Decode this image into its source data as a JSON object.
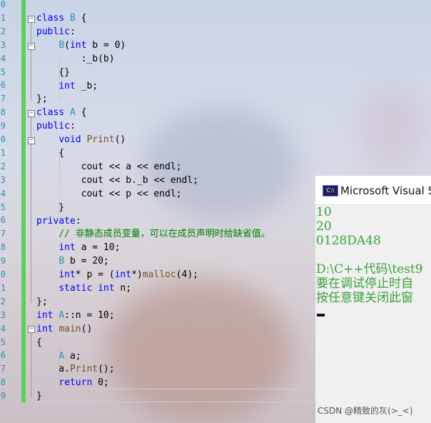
{
  "editor": {
    "line_numbers": [
      "0",
      "1",
      "2",
      "3",
      "4",
      "5",
      "6",
      "7",
      "8",
      "9",
      "0",
      "1",
      "2",
      "3",
      "4",
      "5",
      "6",
      "7",
      "8",
      "9",
      "0",
      "1",
      "2",
      "3",
      "4",
      "5",
      "6",
      "7",
      "8",
      "9"
    ],
    "code": [
      "class B {",
      "public:",
      "    B(int b = 0)",
      "        :_b(b)",
      "    {}",
      "    int _b;",
      "};",
      "class A {",
      "public:",
      "    void Print()",
      "    {",
      "        cout << a << endl;",
      "        cout << b._b << endl;",
      "        cout << p << endl;",
      "    }",
      "private:",
      "    // 非静态成员变量，可以在成员声明时给缺省值。",
      "    int a = 10;",
      "    B b = 20;",
      "    int* p = (int*)malloc(4);",
      "    static int n;",
      "};",
      "int A::n = 10;",
      "int main()",
      "{",
      "    A a;",
      "    a.Print();",
      "    return 0;",
      "}"
    ]
  },
  "console": {
    "title": "Microsoft Visual Studio 调试控制台",
    "output": [
      "10",
      "20",
      "0128DA48",
      "",
      "D:\\C++代码\\test9",
      "要在调试停止时自",
      "按任意键关闭此窗"
    ]
  },
  "watermark": "CSDN @精致的灰(>_<)"
}
